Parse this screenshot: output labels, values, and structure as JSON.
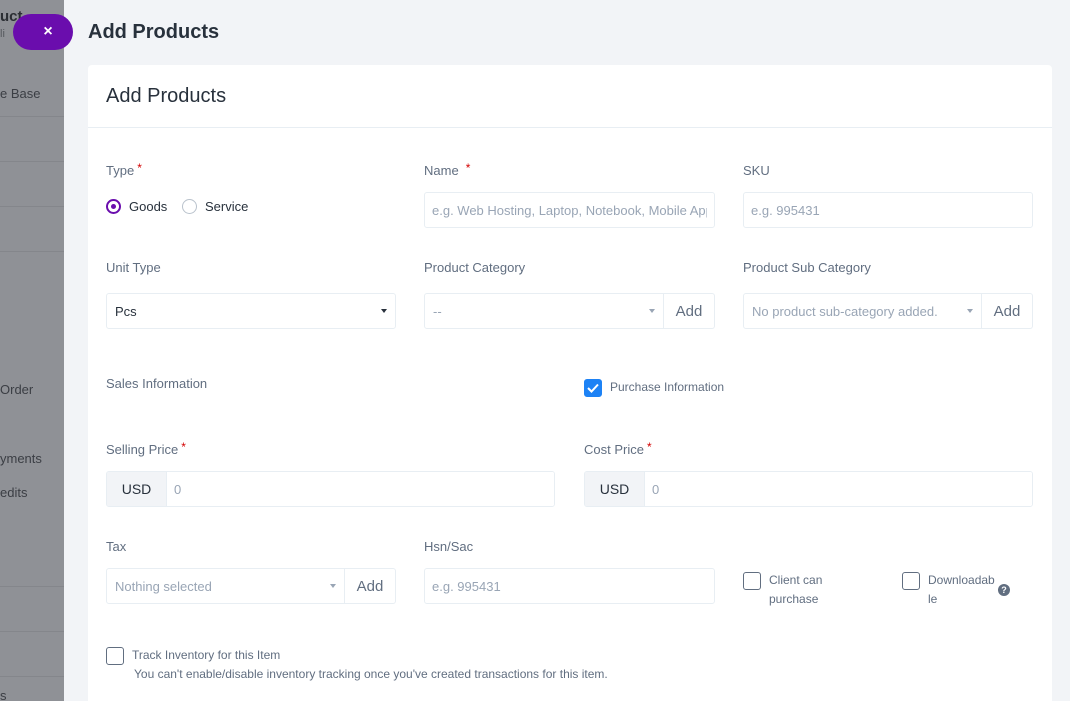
{
  "background": {
    "items": [
      "uct",
      "li",
      "e Base",
      "Order",
      "yments",
      "edits",
      "s"
    ]
  },
  "close_label": "×",
  "panel_title": "Add Products",
  "card_title": "Add Products",
  "form": {
    "type_label": "Type",
    "type_options": [
      "Goods",
      "Service"
    ],
    "name_label": "Name",
    "name_placeholder": "e.g. Web Hosting, Laptop, Notebook, Mobile Apps",
    "sku_label": "SKU",
    "sku_placeholder": "e.g. 995431",
    "unit_type_label": "Unit Type",
    "unit_type_value": "Pcs",
    "product_category_label": "Product Category",
    "product_category_value": "--",
    "add_label": "Add",
    "product_sub_category_label": "Product Sub Category",
    "product_sub_category_value": "No product sub-category added.",
    "sales_information_label": "Sales Information",
    "purchase_information_label": "Purchase Information",
    "selling_price_label": "Selling Price",
    "cost_price_label": "Cost Price",
    "currency": "USD",
    "price_placeholder": "0",
    "tax_label": "Tax",
    "tax_value": "Nothing selected",
    "hsn_label": "Hsn/Sac",
    "hsn_placeholder": "e.g. 995431",
    "client_can_purchase_line1": "Client can",
    "client_can_purchase_line2": "purchase",
    "downloadable_line1": "Downloadab",
    "downloadable_line2": "le",
    "track_inventory_label": "Track Inventory for this Item",
    "track_inventory_note": "You can't enable/disable inventory tracking once you've created transactions for this item.",
    "required_mark": "*",
    "help_glyph": "?"
  },
  "colors": {
    "accent": "#6a0dad",
    "checkbox_blue": "#1d82f5",
    "required": "#d30000"
  }
}
